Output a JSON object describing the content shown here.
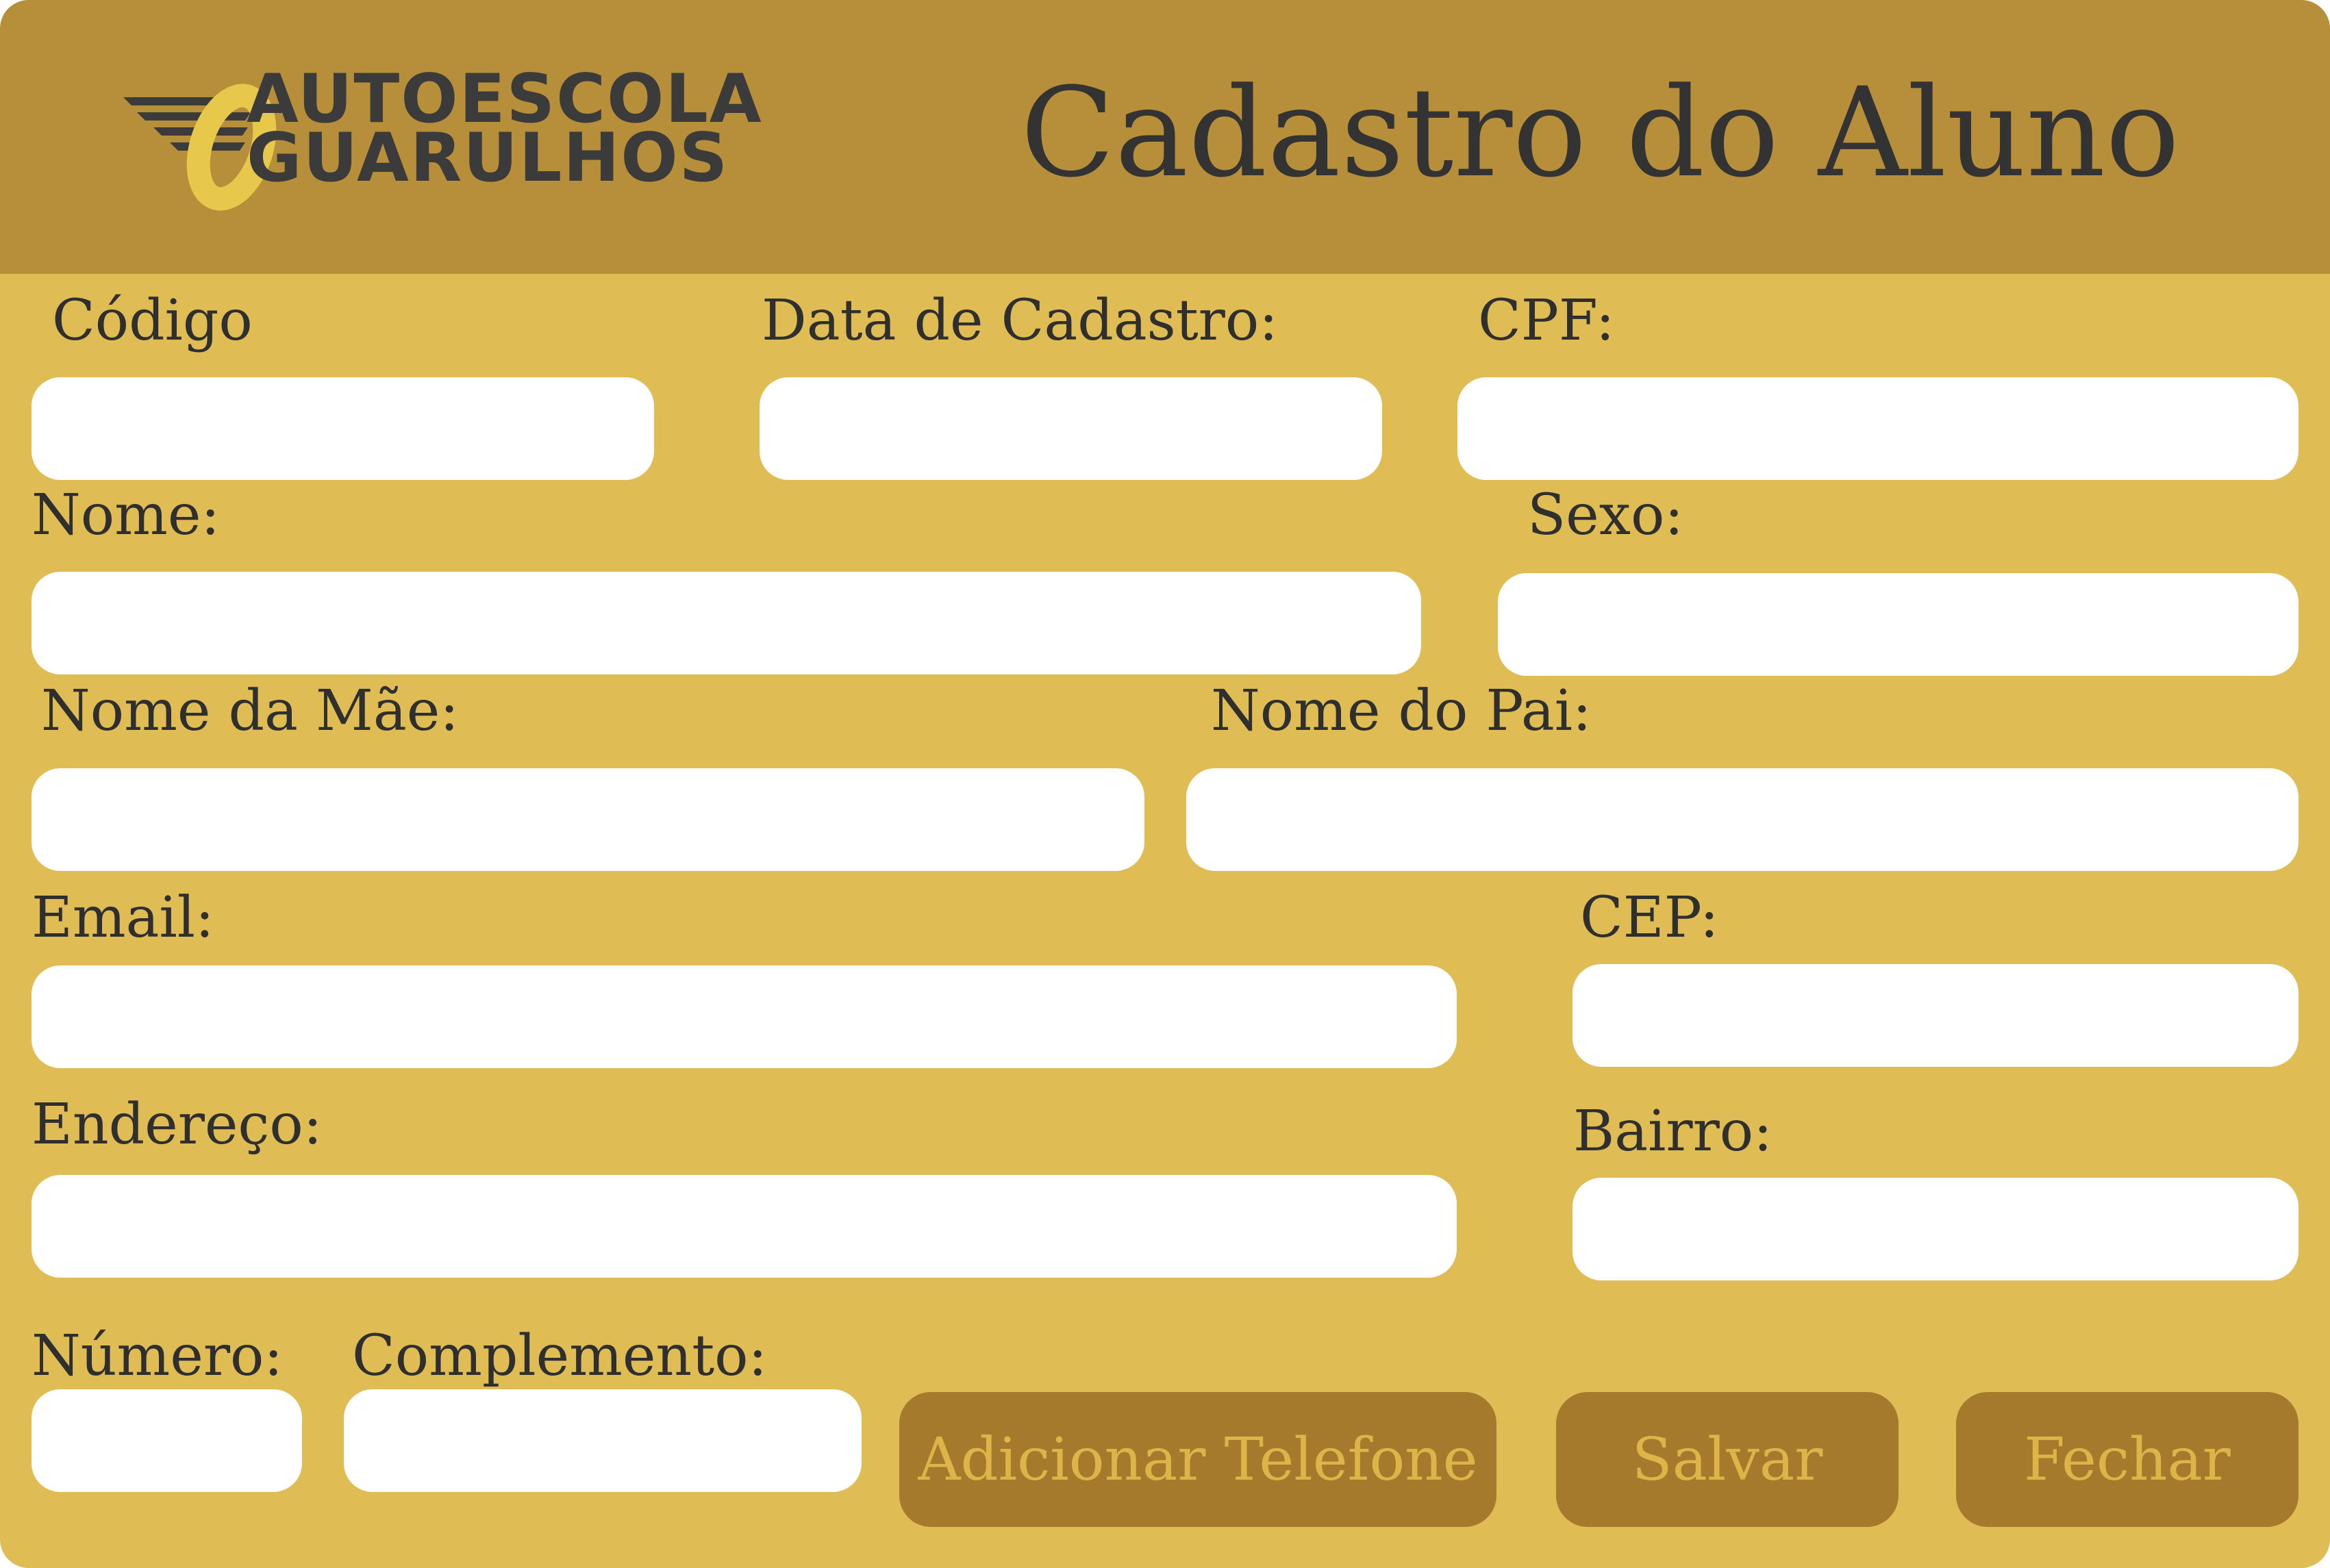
{
  "header": {
    "logo": {
      "line1": "AUTOESCOLA",
      "line2": "GUARULHOS"
    },
    "title": "Cadastro do Aluno"
  },
  "form": {
    "codigo": {
      "label": "Código",
      "value": ""
    },
    "data_cadastro": {
      "label": "Data de Cadastro:",
      "value": ""
    },
    "cpf": {
      "label": "CPF:",
      "value": ""
    },
    "nome": {
      "label": "Nome:",
      "value": ""
    },
    "sexo": {
      "label": "Sexo:",
      "value": ""
    },
    "nome_mae": {
      "label": "Nome da Mãe:",
      "value": ""
    },
    "nome_pai": {
      "label": "Nome do Pai:",
      "value": ""
    },
    "email": {
      "label": "Email:",
      "value": ""
    },
    "cep": {
      "label": "CEP:",
      "value": ""
    },
    "endereco": {
      "label": "Endereço:",
      "value": ""
    },
    "bairro": {
      "label": "Bairro:",
      "value": ""
    },
    "numero": {
      "label": "Número:",
      "value": ""
    },
    "complemento": {
      "label": "Complemento:",
      "value": ""
    }
  },
  "buttons": {
    "add_phone": "Adicionar Telefone",
    "save": "Salvar",
    "close": "Fechar"
  },
  "colors": {
    "header_bg": "#b78f3a",
    "body_bg": "#e0bc54",
    "button_bg": "#a57a2c",
    "button_text": "#dcb448",
    "text": "#2f2f2f",
    "logo_accent": "#e8c84a"
  }
}
